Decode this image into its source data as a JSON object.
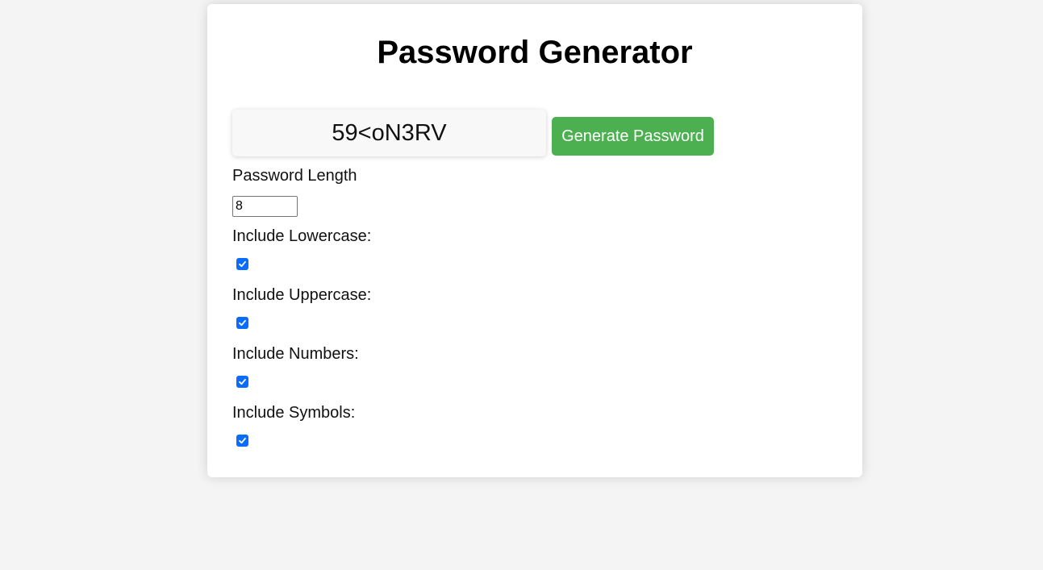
{
  "app": {
    "title": "Password Generator"
  },
  "password": {
    "value": "59<oN3RV"
  },
  "generate_button": {
    "label": "Generate Password"
  },
  "length": {
    "label": "Password Length",
    "value": "8"
  },
  "options": [
    {
      "label": "Include Lowercase:",
      "checked": true
    },
    {
      "label": "Include Uppercase:",
      "checked": true
    },
    {
      "label": "Include Numbers:",
      "checked": true
    },
    {
      "label": "Include Symbols:",
      "checked": true
    }
  ],
  "colors": {
    "accent": "#4caf50",
    "checkbox": "#0a6cff",
    "background": "#f4f4f4",
    "card": "#ffffff"
  },
  "icons": {
    "checkbox": "checkmark-icon"
  }
}
